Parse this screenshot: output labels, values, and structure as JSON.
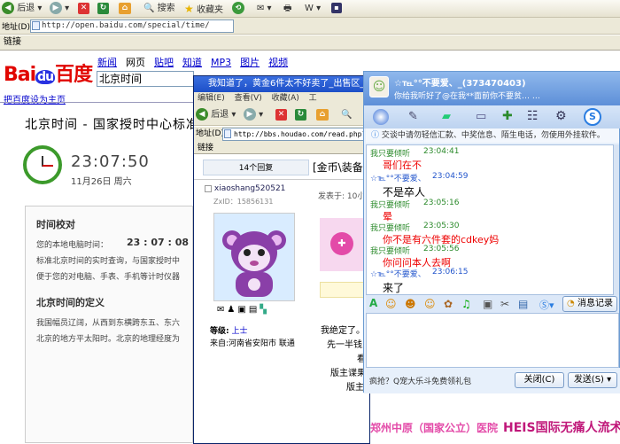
{
  "browser_toolbar": {
    "back": "后退",
    "search": "搜索",
    "favorites": "收藏夹"
  },
  "address": {
    "label": "地址(D)",
    "url": "http://open.baidu.com/special/time/"
  },
  "links_label": "链接",
  "baidu": {
    "logo_bai": "Bai",
    "logo_du": "du",
    "logo_cn": "百度",
    "nav": [
      "新闻",
      "网页",
      "贴吧",
      "知道",
      "MP3",
      "图片",
      "视频"
    ],
    "search_value": "北京时间",
    "set_home": "把百度设为主页",
    "title": "北京时间 - 国家授时中心标准时间",
    "time": "23:07:50",
    "date": "11月26日   周六",
    "calib_heading": "时间校对",
    "local_time_label": "您的本地电脑时间：",
    "local_time_value": "23 : 07 : 08",
    "calib_line1": "标准北京时间的实时查询，与国家授时中",
    "calib_line2": "便于您的对电脑、手表、手机等计时仪器",
    "def_heading": "北京时间的定义",
    "def_line1": "我国幅员辽阔，从西到东横跨东五、东六",
    "def_line2": "北京的地方平太阳时。北京的地理经度为"
  },
  "forum_window": {
    "title": "我知道了，黄金6件太不好卖了_出售区_紫",
    "menu": "编辑(E) 查看(V) 收藏(A) 工",
    "back": "后退",
    "address_label": "地址(D)",
    "url": "http://bbs.houdao.com/read.php?",
    "links": "链接",
    "replies": "14个回复",
    "post_title": "[金币\\装备",
    "username": "xiaoshang520521",
    "zxid": "ZxID：15856131",
    "posted_at": "发表于: 10小",
    "level_label": "等级:",
    "level_value": "上士",
    "from": "来自:河南省安阳市 联通",
    "body1": "我绝定了。",
    "body2": "先一半钱,",
    "body3": "看",
    "body4": "版主谍果",
    "body5": "版主"
  },
  "qq": {
    "title": "☆℡°°不要爱、_(373470403)",
    "status": "你给我听好了@在我**面前你不要贫…  …",
    "notice": "交谈中请勿轻信汇款、中奖信息、陌生电话，勿使用外挂软件。",
    "messages": [
      {
        "sender": "我只要倾听",
        "time": "23:04:41",
        "text": "哥们在不",
        "mine": true
      },
      {
        "sender": "☆℡°°不要爱、",
        "time": "23:04:59",
        "text": "不是卒人",
        "mine": false
      },
      {
        "sender": "我只要倾听",
        "time": "23:05:16",
        "text": "晕",
        "mine": true
      },
      {
        "sender": "我只要倾听",
        "time": "23:05:30",
        "text": "你不是有六件套的cdkey妈",
        "mine": true
      },
      {
        "sender": "我只要倾听",
        "time": "23:05:56",
        "text": "你问问本人去啊",
        "mine": true
      },
      {
        "sender": "☆℡°°不要爱、",
        "time": "23:06:15",
        "text": "来了",
        "mine": false
      }
    ],
    "history_btn": "消息记录",
    "ad": "疯抢？Q宠大乐斗免费领礼包",
    "close_btn": "关闭(C)",
    "send_btn": "发送(S)"
  },
  "banner": {
    "left": "郑州中原（国家公立）医院",
    "right": "HEIS国际无痛人流术"
  },
  "colors": {
    "baidu_red": "#e10601",
    "baidu_blue": "#2932e1",
    "qq_blue": "#5d8fd8",
    "chat_red": "#e00000"
  }
}
